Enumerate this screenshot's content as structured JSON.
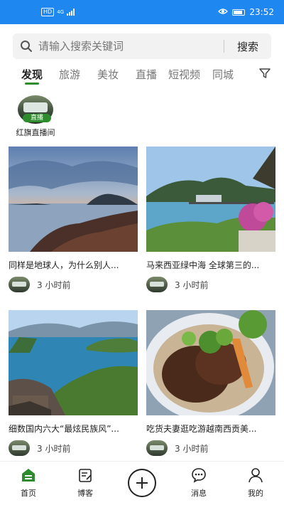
{
  "status_bar": {
    "network": "4G",
    "hd": "HD",
    "time": "23:52"
  },
  "search": {
    "placeholder": "请输入搜索关键词",
    "button_label": "搜索"
  },
  "tabs": [
    {
      "label": "发现",
      "active": true
    },
    {
      "label": "旅游"
    },
    {
      "label": "美妆"
    },
    {
      "label": "直播"
    },
    {
      "label": "短视频"
    },
    {
      "label": "同城"
    }
  ],
  "live": {
    "badge": "直播",
    "label": "红旗直播间"
  },
  "cards": [
    {
      "title": "同样是地球人，为什么别人...",
      "time": "3 小时前"
    },
    {
      "title": "马来西亚绿中海 全球第三的...",
      "time": "3 小时前"
    },
    {
      "title": "细数国内六大“最炫民族风”...",
      "time": "3 小时前"
    },
    {
      "title": "吃货夫妻逛吃游越南西贡美...",
      "time": "3 小时前"
    }
  ],
  "bottom_nav": [
    {
      "label": "首页",
      "active": true
    },
    {
      "label": "博客"
    },
    {
      "label": "消息"
    },
    {
      "label": "我的"
    }
  ],
  "colors": {
    "accent": "#2e8b2e",
    "status_bar": "#1e88f0"
  }
}
